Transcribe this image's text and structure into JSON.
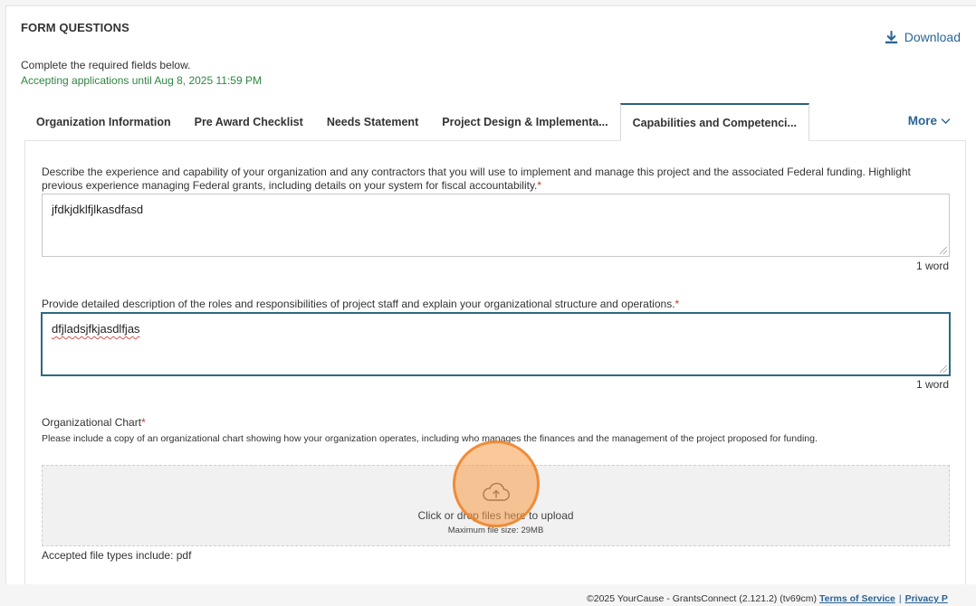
{
  "header": {
    "title": "FORM QUESTIONS",
    "download_label": "Download",
    "intro": "Complete the required fields below.",
    "deadline": "Accepting applications until Aug 8, 2025 11:59 PM"
  },
  "tabs": [
    {
      "label": "Organization Information",
      "active": false
    },
    {
      "label": "Pre Award Checklist",
      "active": false
    },
    {
      "label": "Needs Statement",
      "active": false
    },
    {
      "label": "Project Design & Implementa...",
      "active": false
    },
    {
      "label": "Capabilities and Competenci...",
      "active": true
    }
  ],
  "more_label": "More",
  "questions": {
    "q1": {
      "text": "Describe the experience and capability of your organization and any contractors that you will use to implement and manage this project and the associated Federal funding. Highlight previous experience managing Federal grants, including details on your system for fiscal accountability.",
      "required_mark": "*",
      "value": "jfdkjdklfjlkasdfasd",
      "word_count": "1 word"
    },
    "q2": {
      "text": "Provide detailed description of the roles and responsibilities of project staff and explain your organizational structure and operations.",
      "required_mark": "*",
      "value": "dfjladsjfkjasdlfjas",
      "word_count": "1 word"
    },
    "q3": {
      "label": "Organizational Chart",
      "required_mark": "*",
      "help": "Please include a copy of an organizational chart showing how your organization operates, including who manages the finances and the management of the project proposed for funding.",
      "upload_text": "Click or drop files here to upload",
      "max_size": "Maximum file size: 29MB",
      "accepted": "Accepted file types include: pdf"
    }
  },
  "footer": {
    "copyright": "©2025 YourCause - GrantsConnect (2.121.2) (tv69cm)",
    "terms_label": "Terms of Service",
    "separator": "|",
    "privacy_label": "Privacy P"
  },
  "colors": {
    "link": "#2a6496",
    "deadline": "#2e8540",
    "required": "#c0392b",
    "active_tab_border": "#2d5f7f",
    "cursor_highlight": "#f5a04a"
  }
}
